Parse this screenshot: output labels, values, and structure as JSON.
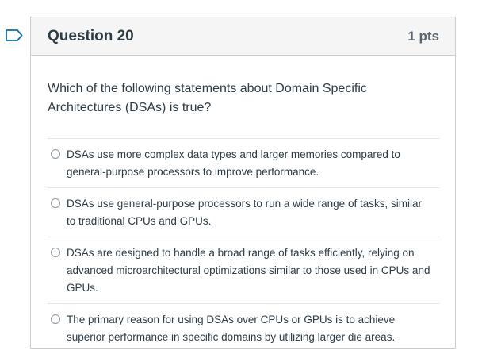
{
  "question": {
    "title": "Question 20",
    "points": "1 pts",
    "text": "Which of the following statements about Domain Specific Architectures (DSAs) is true?",
    "answers": [
      {
        "text": "DSAs use more complex data types and larger memories compared to general-purpose processors to improve performance."
      },
      {
        "text": "DSAs use general-purpose processors to run a wide range of tasks, similar to traditional CPUs and GPUs."
      },
      {
        "text": "DSAs are designed to handle a broad range of tasks efficiently, relying on advanced microarchitectural optimizations similar to those used in CPUs and GPUs."
      },
      {
        "text": "The primary reason for using DSAs over CPUs or GPUs is to achieve superior performance in specific domains by utilizing larger die areas."
      }
    ]
  },
  "colors": {
    "flag": "#0770a3",
    "header_bg": "#f5f5f5",
    "border": "#c7cdd1",
    "text": "#2d3b45"
  }
}
